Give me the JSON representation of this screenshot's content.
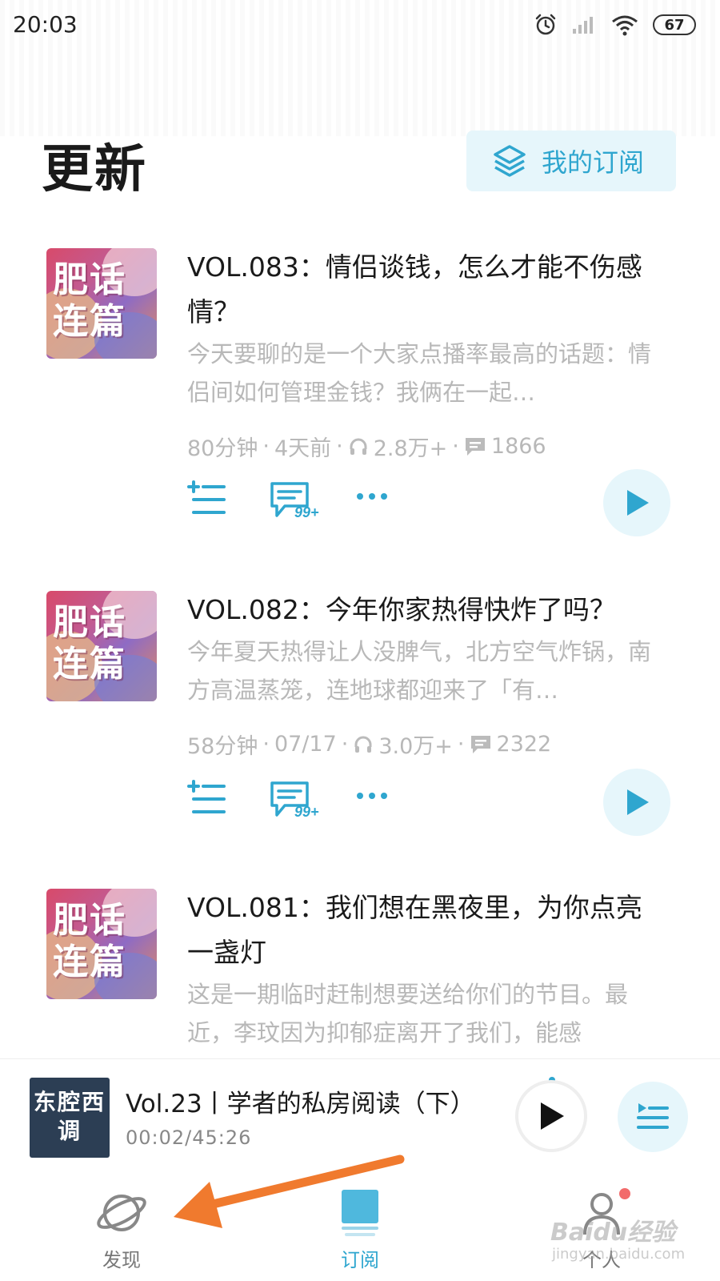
{
  "status_bar": {
    "time": "20:03",
    "battery": "67"
  },
  "header": {
    "title": "更新",
    "my_subscriptions_label": "我的订阅"
  },
  "episodes": [
    {
      "title": "VOL.083：情侣谈钱，怎么才能不伤感情？",
      "description": "今天要聊的是一个大家点播率最高的话题：情侣间如何管理金钱？我俩在一起…",
      "duration": "80分钟",
      "date": "4天前",
      "plays": "2.8万+",
      "comments": "1866",
      "comment_badge": "99+",
      "cover_text": "肥话连篇"
    },
    {
      "title": "VOL.082：今年你家热得快炸了吗？",
      "description": "今年夏天热得让人没脾气，北方空气炸锅，南方高温蒸笼，连地球都迎来了「有…",
      "duration": "58分钟",
      "date": "07/17",
      "plays": "3.0万+",
      "comments": "2322",
      "comment_badge": "99+",
      "cover_text": "肥话连篇"
    },
    {
      "title": "VOL.081：我们想在黑夜里，为你点亮一盏灯",
      "description": "这是一期临时赶制想要送给你们的节目。最近，李玟因为抑郁症离开了我们，能感",
      "cover_text": "肥话连篇"
    }
  ],
  "mini_player": {
    "cover_text": "东腔西调",
    "title": "Vol.23丨学者的私房阅读（下）",
    "time": "00:02/45:26"
  },
  "tabs": [
    {
      "label": "发现",
      "icon": "planet-icon",
      "active": false
    },
    {
      "label": "订阅",
      "icon": "subscribe-stack-icon",
      "active": true
    },
    {
      "label": "个人",
      "icon": "person-icon",
      "active": false
    }
  ],
  "watermark": {
    "main": "Baidu经验",
    "sub": "jingyan.baidu.com"
  },
  "colors": {
    "accent": "#2fa6cf",
    "accent_bg": "#e6f6fb",
    "annotation_arrow": "#f07a2e"
  }
}
